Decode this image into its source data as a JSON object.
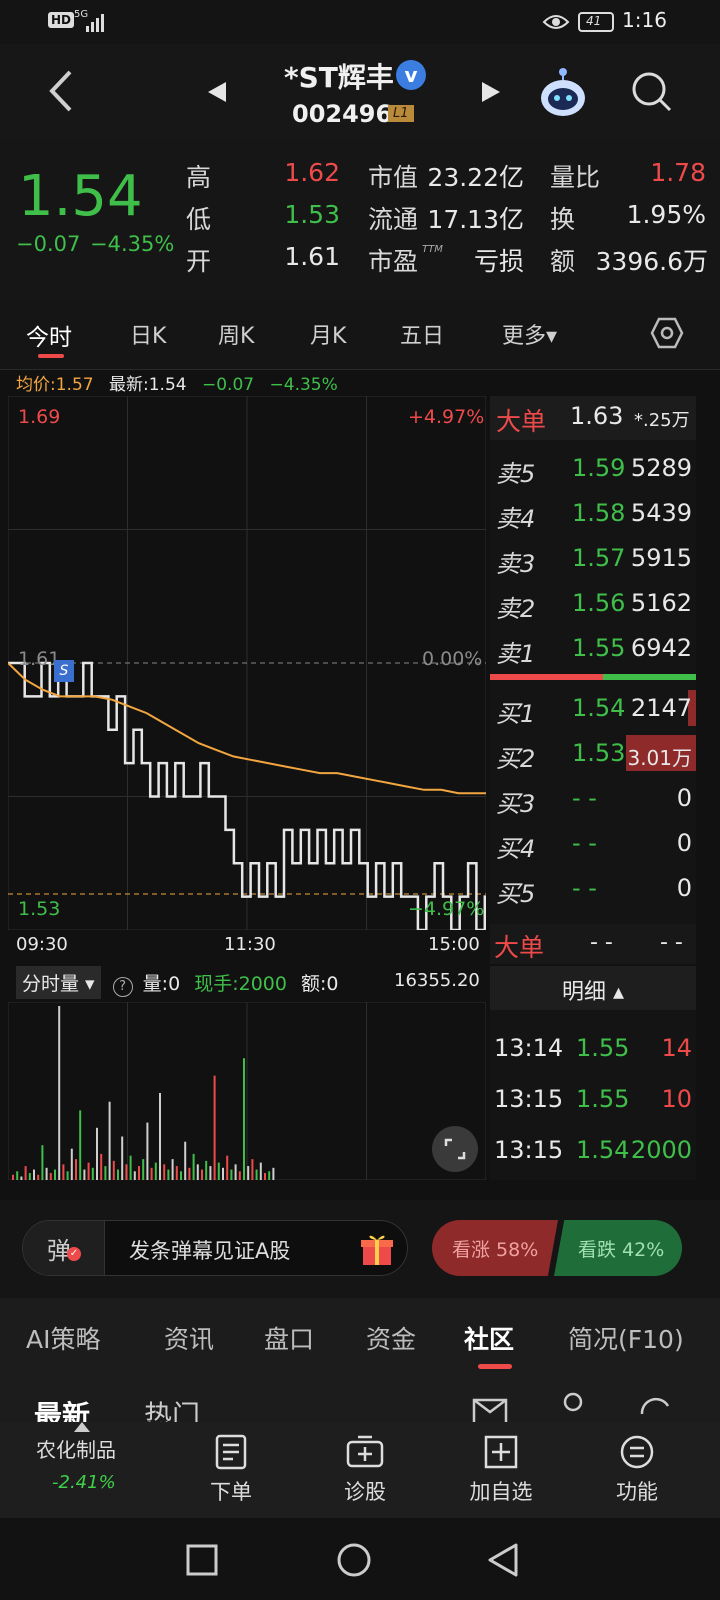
{
  "status": {
    "time": "1:16",
    "battery": "41",
    "hd": "HD",
    "signal": "5G"
  },
  "header": {
    "name": "*ST辉丰",
    "code": "002496",
    "level_badge": "L1"
  },
  "quote": {
    "price": "1.54",
    "change": "−0.07",
    "change_pct": "−4.35%",
    "high_label": "高",
    "high": "1.62",
    "low_label": "低",
    "low": "1.53",
    "open_label": "开",
    "open": "1.61",
    "mktcap_label": "市值",
    "mktcap": "23.22亿",
    "float_label": "流通",
    "float": "17.13亿",
    "pe_label": "市盈",
    "pe_sup": "TTM",
    "pe": "亏损",
    "vr_label": "量比",
    "vr": "1.78",
    "turn_label": "换",
    "turn": "1.95%",
    "amt_label": "额",
    "amt": "3396.6万"
  },
  "ktabs": [
    "今时",
    "日K",
    "周K",
    "月K",
    "五日",
    "更多▾"
  ],
  "chart_info": {
    "avg_label": "均价:",
    "avg": "1.57",
    "latest_label": "最新:",
    "latest": "1.54",
    "chg": "−0.07",
    "chg_pct": "−4.35%"
  },
  "chart_data": {
    "type": "line",
    "price_top": "1.69",
    "pct_top": "+4.97%",
    "price_mid": "1.61",
    "pct_mid": "0.00%",
    "price_bottom": "1.53",
    "pct_bottom": "−4.97%",
    "ylim": [
      1.53,
      1.69
    ],
    "x_labels": [
      "09:30",
      "11:30",
      "15:00"
    ],
    "price": [
      1.61,
      1.61,
      1.6,
      1.6,
      1.61,
      1.6,
      1.61,
      1.6,
      1.6,
      1.61,
      1.6,
      1.6,
      1.59,
      1.6,
      1.58,
      1.59,
      1.58,
      1.57,
      1.58,
      1.57,
      1.58,
      1.57,
      1.57,
      1.58,
      1.57,
      1.57,
      1.56,
      1.55,
      1.54,
      1.55,
      1.54,
      1.55,
      1.54,
      1.56,
      1.55,
      1.56,
      1.55,
      1.56,
      1.55,
      1.56,
      1.55,
      1.56,
      1.55,
      1.54,
      1.55,
      1.54,
      1.55,
      1.54,
      1.54,
      1.53,
      1.54,
      1.55,
      1.54,
      1.53,
      1.54,
      1.55,
      1.53,
      1.54,
      1.53,
      1.54,
      1.54,
      1.55,
      1.54
    ],
    "avg": [
      1.61,
      1.605,
      1.602,
      1.6,
      1.6,
      1.6,
      1.599,
      1.597,
      1.595,
      1.592,
      1.589,
      1.586,
      1.584,
      1.582,
      1.581,
      1.58,
      1.579,
      1.578,
      1.577,
      1.577,
      1.576,
      1.575,
      1.574,
      1.573,
      1.572,
      1.572,
      1.571,
      1.571,
      1.571,
      1.57,
      1.57
    ],
    "volume": [
      3,
      5,
      2,
      8,
      4,
      6,
      3,
      20,
      7,
      4,
      6,
      100,
      9,
      5,
      18,
      12,
      40,
      6,
      10,
      7,
      30,
      15,
      8,
      45,
      11,
      6,
      25,
      9,
      14,
      5,
      8,
      12,
      33,
      7,
      10,
      50,
      9,
      6,
      12,
      8,
      5,
      22,
      7,
      15,
      9,
      6,
      11,
      8,
      60,
      10,
      7,
      14,
      6,
      9,
      5,
      70,
      8,
      12,
      6,
      10,
      4,
      5,
      7
    ],
    "vol_max": "16355.20",
    "vol_tab": "分时量 ▾",
    "vol_q": "量:0",
    "vol_now": "现手:2000",
    "vol_amt": "额:0"
  },
  "orderbook": {
    "big_sell_label": "大单",
    "big_sell_price": "1.63",
    "big_sell_vol": "*.25万",
    "asks": [
      {
        "label": "卖5",
        "price": "1.59",
        "vol": "5289",
        "bar": 0.1
      },
      {
        "label": "卖4",
        "price": "1.58",
        "vol": "5439",
        "bar": 0.12
      },
      {
        "label": "卖3",
        "price": "1.57",
        "vol": "5915",
        "bar": 0.14
      },
      {
        "label": "卖2",
        "price": "1.56",
        "vol": "5162",
        "bar": 0.1
      },
      {
        "label": "卖1",
        "price": "1.55",
        "vol": "6942",
        "bar": 0.16
      }
    ],
    "bids": [
      {
        "label": "买1",
        "price": "1.54",
        "vol": "2147",
        "bar": 0.04
      },
      {
        "label": "买2",
        "price": "1.53",
        "vol": "3.01万",
        "bar": 0.34
      },
      {
        "label": "买3",
        "price": "- -",
        "vol": "0",
        "bar": 0
      },
      {
        "label": "买4",
        "price": "- -",
        "vol": "0",
        "bar": 0
      },
      {
        "label": "买5",
        "price": "- -",
        "vol": "0",
        "bar": 0
      }
    ],
    "ratio_sell": 0.55,
    "big_buy_label": "大单",
    "big_buy_price": "- -",
    "big_buy_vol": "- -",
    "detail_label": "明细 ▴",
    "ticks": [
      {
        "time": "13:14",
        "price": "1.55",
        "vol": "14",
        "vol_color": "red"
      },
      {
        "time": "13:15",
        "price": "1.55",
        "vol": "10",
        "vol_color": "red"
      },
      {
        "time": "13:15",
        "price": "1.54",
        "vol": "2000",
        "vol_color": "green"
      }
    ]
  },
  "danmu": {
    "tag": "弹",
    "placeholder": "发条弹幕见证A股",
    "up_label": "看涨 58%",
    "down_label": "看跌 42%",
    "up_pct": 58
  },
  "btabs": [
    "AI策略",
    "资讯",
    "盘口",
    "资金",
    "社区",
    "简况(F10)"
  ],
  "subrow": {
    "latest": "最新",
    "hot": "热门"
  },
  "toolbar": {
    "sector": "农化制品",
    "sector_pct": "-2.41%",
    "order": "下单",
    "diagnose": "诊股",
    "watch": "加自选",
    "func": "功能"
  }
}
